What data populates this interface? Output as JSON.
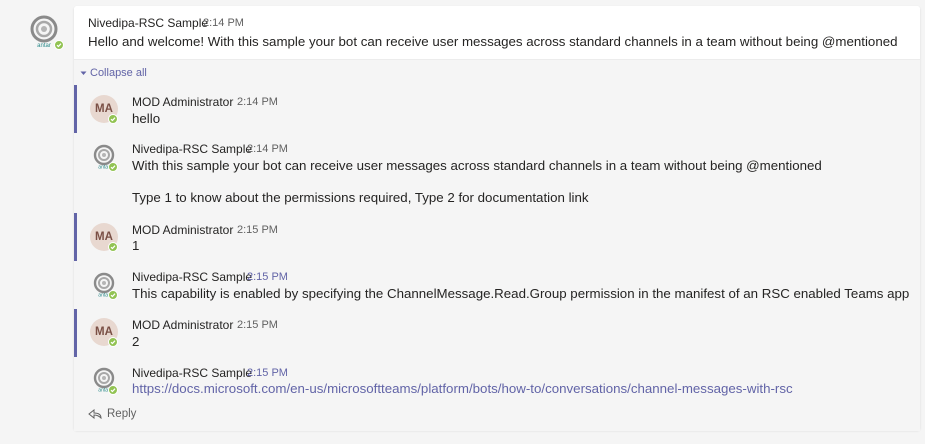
{
  "root_message": {
    "author": "Nivedipa-RSC Sample",
    "time": "2:14 PM",
    "text": "Hello and welcome! With this sample your bot can receive user messages across standard channels in a team without being @mentioned"
  },
  "collapse_label": "Collapse all",
  "replies": [
    {
      "author": "MOD Administrator",
      "initials": "MA",
      "time": "2:14 PM",
      "lines": [
        "hello"
      ]
    },
    {
      "author": "Nivedipa-RSC Sample",
      "time": "2:14 PM",
      "lines": [
        "With this sample your bot can receive user messages across standard channels in a team without being @mentioned",
        "Type 1 to know about the permissions required, Type 2 for documentation link"
      ]
    },
    {
      "author": "MOD Administrator",
      "initials": "MA",
      "time": "2:15 PM",
      "lines": [
        "1"
      ]
    },
    {
      "author": "Nivedipa-RSC Sample",
      "time": "2:15 PM",
      "lines": [
        "This capability is enabled by specifying the ChannelMessage.Read.Group permission in the manifest of an RSC enabled Teams app"
      ]
    },
    {
      "author": "MOD Administrator",
      "initials": "MA",
      "time": "2:15 PM",
      "lines": [
        "2"
      ]
    },
    {
      "author": "Nivedipa-RSC Sample",
      "time": "2:15 PM",
      "lines": [
        "https://docs.microsoft.com/en-us/microsoftteams/platform/bots/how-to/conversations/channel-messages-with-rsc"
      ]
    }
  ],
  "reply_label": "Reply",
  "icons": {
    "bot_avatar": "bot-logo-icon",
    "presence": "available-check-icon",
    "collapse": "chevron-down-icon",
    "reply": "reply-arrow-icon"
  },
  "colors": {
    "accent": "#6264a7",
    "presence": "#92c353",
    "user_avatar_bg": "#e8d8d0"
  }
}
